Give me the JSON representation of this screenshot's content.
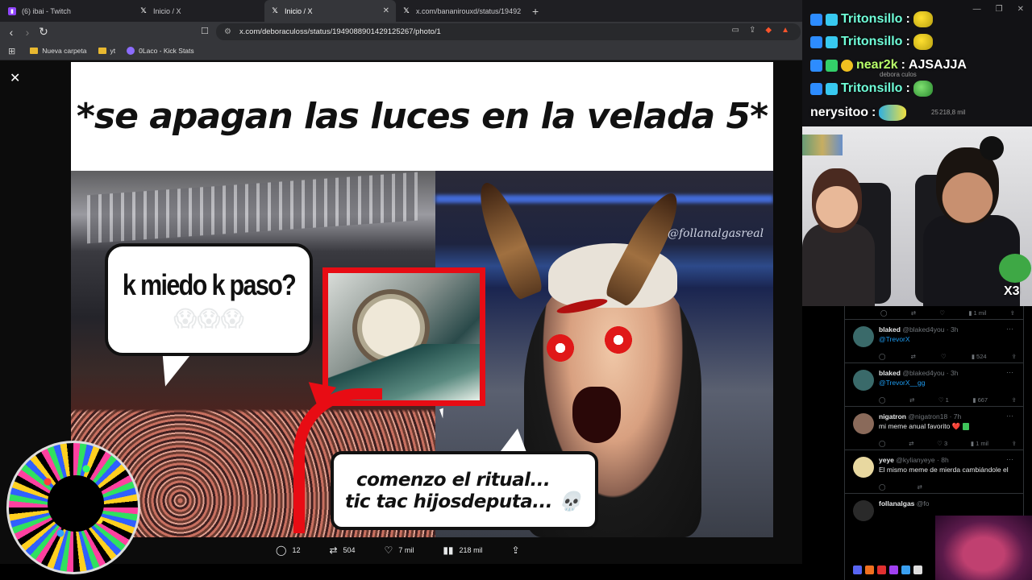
{
  "browser": {
    "tabs": [
      {
        "label": "(6) ibai - Twitch",
        "favicon": "twitch-icon",
        "active": false
      },
      {
        "label": "Inicio / X",
        "favicon": "x-logo-icon",
        "active": false
      },
      {
        "label": "Inicio / X",
        "favicon": "x-logo-icon",
        "active": true
      },
      {
        "label": "x.com/bananirouxd/status/19492330",
        "favicon": "x-logo-icon",
        "active": false
      }
    ],
    "url": "x.com/deboraculoss/status/1949088901429125267/photo/1",
    "bookmarks": [
      {
        "label": "Nueva carpeta",
        "icon": "folder-icon"
      },
      {
        "label": "yt",
        "icon": "folder-icon"
      },
      {
        "label": "0Laco - Kick Stats",
        "icon": "kick-icon"
      }
    ],
    "brand_color": "#fb542b"
  },
  "meme": {
    "caption": "*se apagan las luces en la velada 5*",
    "bubble_left_text": "k miedo k paso?",
    "bubble_left_emoji": "😱😱😱",
    "watermark": "@follanalgasreal",
    "bubble_bottom_line1": "comenzo el ritual...",
    "bubble_bottom_line2": "tic tac hijosdeputa... 💀",
    "accent_color": "#e80c14"
  },
  "post_actions": {
    "replies": "12",
    "reposts": "504",
    "likes": "7 mil",
    "views": "218 mil"
  },
  "stream_chat": {
    "lines": [
      {
        "user": "Tritonsillo",
        "sep": ":",
        "text": ""
      },
      {
        "user": "Tritonsillo",
        "sep": ":",
        "text": ""
      },
      {
        "user": "near2k",
        "sep": ":",
        "text": "AJSAJJA"
      },
      {
        "user": "Tritonsillo",
        "sep": ":",
        "text": ""
      },
      {
        "user": "nerysitoo",
        "sep": ":",
        "text": ""
      }
    ],
    "behind_text": {
      "name": "debora culos",
      "views": "218,8 mil",
      "time": "25"
    }
  },
  "webcam": {
    "multiplier": "X3"
  },
  "replies_panel": {
    "top_metrics": {
      "views": "1 mil"
    },
    "replies": [
      {
        "name": "blaked",
        "handle": "@blaked4you",
        "time": "3h",
        "text": "@TrevorX",
        "is_link": true,
        "likes": "",
        "views": "524",
        "avatar_color": "#3a6a6a"
      },
      {
        "name": "blaked",
        "handle": "@blaked4you",
        "time": "3h",
        "text": "@TrevorX__gg",
        "is_link": true,
        "likes": "1",
        "views": "667",
        "avatar_color": "#3a6a6a"
      },
      {
        "name": "nigatron",
        "handle": "@nigatron18",
        "time": "7h",
        "text": "mi meme anual favorito ❤️",
        "is_link": false,
        "likes": "3",
        "views": "1 mil",
        "avatar_color": "#8a6a5a"
      },
      {
        "name": "yeye",
        "handle": "@kylianyeye",
        "time": "8h",
        "text": "El mismo meme de mierda cambiándole el",
        "is_link": false,
        "likes": "",
        "views": "",
        "avatar_color": "#e8d8a0"
      },
      {
        "name": "follanalgas",
        "handle": "@fo",
        "time": "",
        "text": "",
        "is_link": false,
        "likes": "",
        "views": "",
        "avatar_color": "#2a2a2a"
      }
    ]
  }
}
